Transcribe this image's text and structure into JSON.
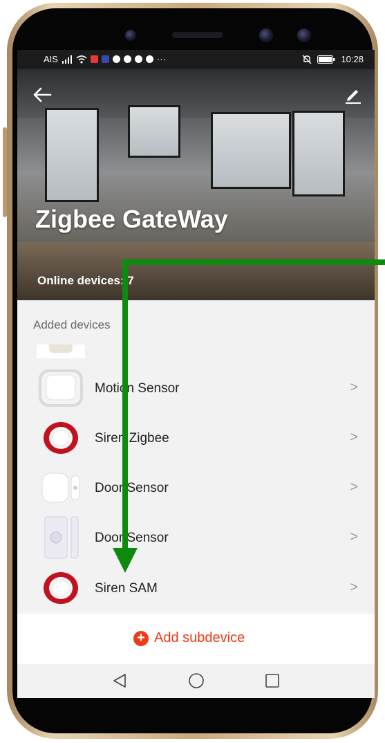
{
  "status_bar": {
    "carrier": "AIS",
    "dots": "···",
    "time": "10:28"
  },
  "header": {
    "title": "Zigbee GateWay",
    "online_devices": "Online devices: 7",
    "back_icon": "arrow-left-icon",
    "edit_icon": "pencil-icon"
  },
  "section": {
    "label": "Added devices"
  },
  "devices": [
    {
      "name": "Motion Sensor",
      "icon": "motion-sensor-icon"
    },
    {
      "name": "Siren Zigbee",
      "icon": "siren-icon"
    },
    {
      "name": "Door Sensor",
      "icon": "door-sensor-icon"
    },
    {
      "name": "Door Sensor",
      "icon": "door-sensor-icon"
    },
    {
      "name": "Siren SAM",
      "icon": "siren-icon"
    }
  ],
  "chevron": ">",
  "add_subdevice": {
    "label": "Add subdevice",
    "icon": "plus-circle-icon",
    "color": "#ee3a16"
  },
  "nav": {
    "back_icon": "nav-back-icon",
    "home_icon": "nav-home-icon",
    "recent_icon": "nav-recent-icon"
  },
  "annotation_color": "#0e8a0e"
}
